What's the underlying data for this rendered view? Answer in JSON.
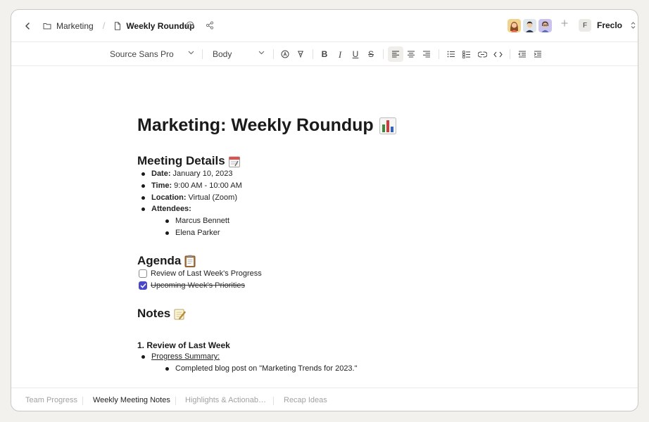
{
  "breadcrumb": {
    "folder": "Marketing",
    "separator": "/",
    "document": "Weekly Roundup"
  },
  "user": {
    "initial": "F",
    "name": "Freclo"
  },
  "toolbar": {
    "font": "Source Sans Pro",
    "style": "Body",
    "bold": "B",
    "italic": "I",
    "underline": "U",
    "strike": "S"
  },
  "document": {
    "title": "Marketing: Weekly Roundup",
    "title_emoji": "bar-chart-icon",
    "meeting_details": {
      "heading": "Meeting Details",
      "date_label": "Date:",
      "date_value": "January 10, 2023",
      "time_label": "Time:",
      "time_value": "9:00 AM - 10:00 AM",
      "location_label": "Location:",
      "location_value": "Virtual (Zoom)",
      "attendees_label": "Attendees:",
      "attendees": [
        "Marcus Bennett",
        "Elena Parker"
      ]
    },
    "agenda": {
      "heading": "Agenda",
      "items": [
        {
          "label": "Review of Last Week's Progress",
          "checked": false
        },
        {
          "label": "Upcoming Week's Priorities",
          "checked": true
        }
      ]
    },
    "notes": {
      "heading": "Notes",
      "subheading": "1. Review of Last Week",
      "item_label": "Progress Summary:",
      "sub_item": "Completed blog post on \"Marketing Trends for 2023.\""
    }
  },
  "tabs": [
    {
      "label": "Team Progress",
      "active": false
    },
    {
      "label": "Weekly Meeting Notes",
      "active": true
    },
    {
      "label": "Highlights & Actionab…",
      "active": false
    },
    {
      "label": "Recap Ideas",
      "active": false
    }
  ],
  "colors": {
    "accent": "#4a48c8",
    "background": "#f2f1ee"
  }
}
